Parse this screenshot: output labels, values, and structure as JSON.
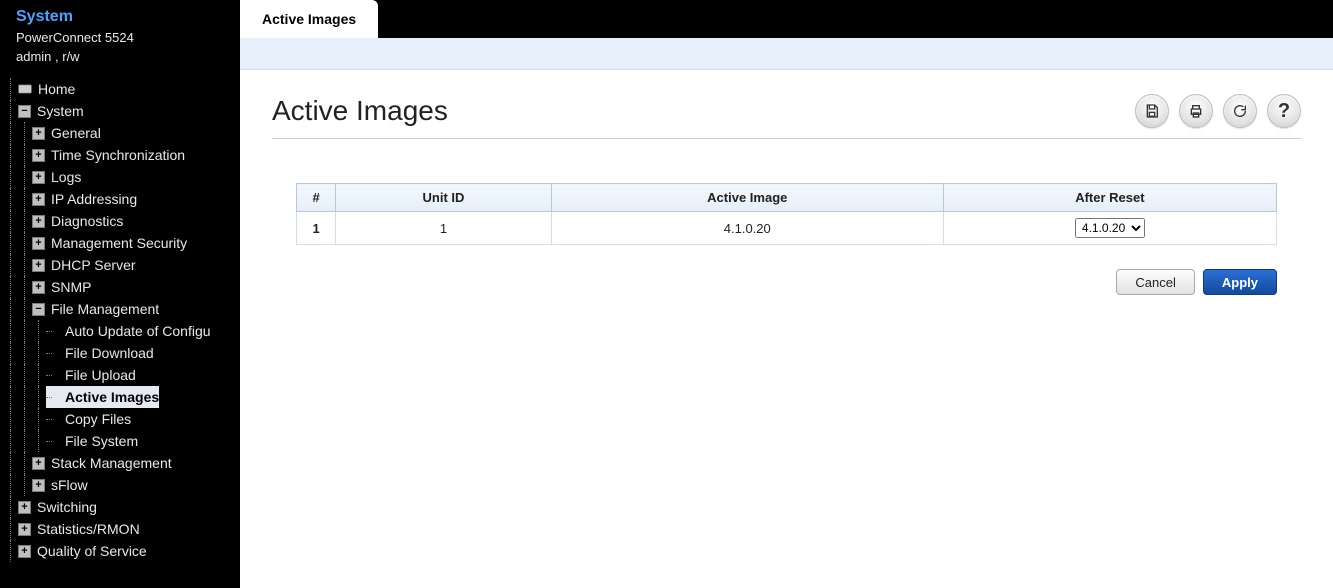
{
  "sidebar": {
    "title": "System",
    "device": "PowerConnect 5524",
    "user_line": "admin , r/w",
    "tree": {
      "home": "Home",
      "root": "System",
      "children": [
        "General",
        "Time Synchronization",
        "Logs",
        "IP Addressing",
        "Diagnostics",
        "Management Security",
        "DHCP Server",
        "SNMP"
      ],
      "file_mgmt": {
        "label": "File Management",
        "children": [
          "Auto Update of Configu",
          "File Download",
          "File Upload",
          "Active Images",
          "Copy Files",
          "File System"
        ],
        "selected_index": 3
      },
      "after_file_mgmt": [
        "Stack Management",
        "sFlow"
      ],
      "top_level": [
        "Switching",
        "Statistics/RMON",
        "Quality of Service"
      ]
    }
  },
  "tab": {
    "active_label": "Active Images"
  },
  "page": {
    "title": "Active Images",
    "table": {
      "headers": [
        "#",
        "Unit ID",
        "Active Image",
        "After Reset"
      ],
      "rows": [
        {
          "num": "1",
          "unit_id": "1",
          "active_image": "4.1.0.20",
          "after_reset_selected": "4.1.0.20",
          "after_reset_options": [
            "4.1.0.20"
          ]
        }
      ]
    },
    "buttons": {
      "cancel": "Cancel",
      "apply": "Apply"
    }
  }
}
